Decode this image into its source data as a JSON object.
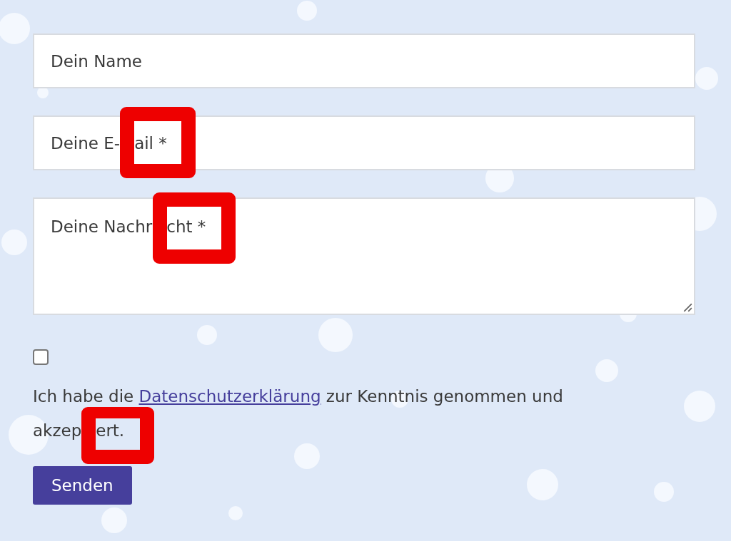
{
  "fields": [
    {
      "kind": "input",
      "placeholder": "Dein Name"
    },
    {
      "kind": "input",
      "placeholder": "Deine E-",
      "covered_placeholder": "ail *"
    },
    {
      "kind": "textarea",
      "placeholder": "Deine Nachr",
      "covered_placeholder": "cht *"
    }
  ],
  "consent": {
    "checked": false,
    "text_before": "Ich habe die ",
    "link": "Datenschutzerklärung",
    "text_after": " zur Kenntnis genommen und",
    "second_line": "akzep",
    "covered_second_line": "ert."
  },
  "submit": "Senden"
}
